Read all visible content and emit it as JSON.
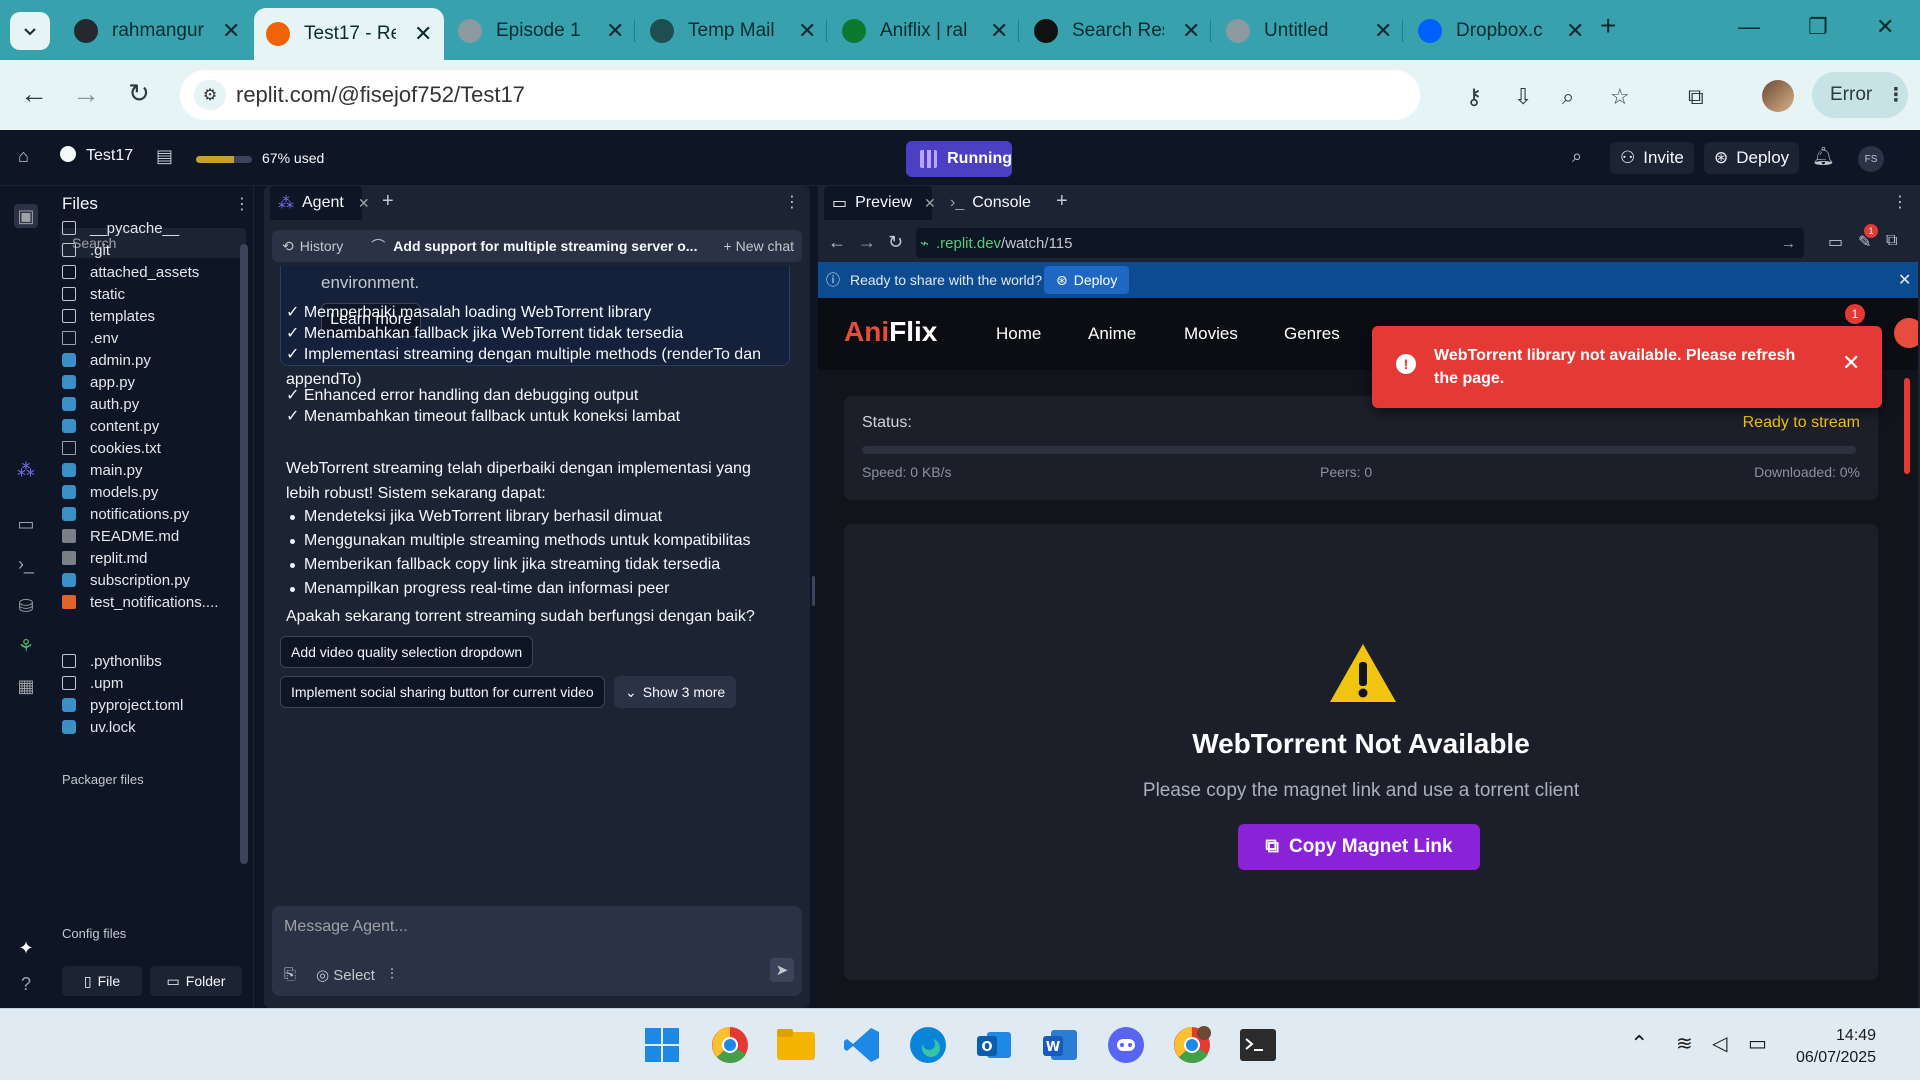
{
  "browser": {
    "tabs": [
      {
        "label": "rahmangur",
        "favicon": "github-icon",
        "color": "#24292e"
      },
      {
        "label": "Test17 - Re",
        "favicon": "replit-icon",
        "color": "#f26207",
        "active": true
      },
      {
        "label": "Episode 1",
        "favicon": "globe-icon",
        "color": "#8a9aa0"
      },
      {
        "label": "Temp Mail",
        "favicon": "tempmail-icon",
        "color": "#1f4e4f"
      },
      {
        "label": "Aniflix | ral",
        "favicon": "aniflix-icon",
        "color": "#0b7a2e"
      },
      {
        "label": "Search Res",
        "favicon": "search-engine-icon",
        "color": "#111111"
      },
      {
        "label": "Untitled",
        "favicon": "globe-icon",
        "color": "#8a9aa0"
      },
      {
        "label": "Dropbox.c",
        "favicon": "dropbox-icon",
        "color": "#0061fe"
      }
    ],
    "url": "replit.com/@fisejof752/Test17",
    "profile_status": "Error"
  },
  "replit": {
    "project_name": "Test17",
    "usage_text": "67% used",
    "usage_fraction": 0.67,
    "run_status": "Running",
    "invite_label": "Invite",
    "deploy_label": "Deploy",
    "user_initials": "FS"
  },
  "files_pane": {
    "title": "Files",
    "search_placeholder": "Search",
    "items": [
      {
        "name": "__pycache__",
        "type": "folder"
      },
      {
        "name": ".git",
        "type": "folder"
      },
      {
        "name": "attached_assets",
        "type": "folder"
      },
      {
        "name": "static",
        "type": "folder"
      },
      {
        "name": "templates",
        "type": "folder"
      },
      {
        "name": ".env",
        "type": "file"
      },
      {
        "name": "admin.py",
        "type": "py"
      },
      {
        "name": "app.py",
        "type": "py"
      },
      {
        "name": "auth.py",
        "type": "py"
      },
      {
        "name": "content.py",
        "type": "py"
      },
      {
        "name": "cookies.txt",
        "type": "file"
      },
      {
        "name": "main.py",
        "type": "py"
      },
      {
        "name": "models.py",
        "type": "py"
      },
      {
        "name": "notifications.py",
        "type": "py"
      },
      {
        "name": "README.md",
        "type": "md"
      },
      {
        "name": "replit.md",
        "type": "md"
      },
      {
        "name": "subscription.py",
        "type": "py"
      },
      {
        "name": "test_notifications....",
        "type": "html"
      }
    ],
    "packager_label": "Packager files",
    "packager_items": [
      {
        "name": ".pythonlibs",
        "type": "folder"
      },
      {
        "name": ".upm",
        "type": "folder"
      },
      {
        "name": "pyproject.toml",
        "type": "py"
      },
      {
        "name": "uv.lock",
        "type": "py"
      }
    ],
    "config_label": "Config files",
    "new_file_label": "File",
    "new_folder_label": "Folder"
  },
  "agent_pane": {
    "tab_label": "Agent",
    "history_label": "History",
    "chat_title": "Add support for multiple streaming server o...",
    "new_chat_label": "New chat",
    "info_text": "environment.",
    "learn_more_label": "Learn more",
    "checklist": [
      "✓ Memperbaiki masalah loading WebTorrent library",
      "✓ Menambahkan fallback jika WebTorrent tidak tersedia",
      "✓ Implementasi streaming dengan multiple methods (renderTo dan appendTo)",
      "✓ Enhanced error handling dan debugging output",
      "✓ Menambahkan timeout fallback untuk koneksi lambat"
    ],
    "summary": "WebTorrent streaming telah diperbaiki dengan implementasi yang lebih robust! Sistem sekarang dapat:",
    "bullets": [
      "Mendeteksi jika WebTorrent library berhasil dimuat",
      "Menggunakan multiple streaming methods untuk kompatibilitas",
      "Memberikan fallback copy link jika streaming tidak tersedia",
      "Menampilkan progress real-time dan informasi peer"
    ],
    "question": "Apakah sekarang torrent streaming sudah berfungsi dengan baik?",
    "suggestions": [
      "Add video quality selection dropdown",
      "Implement social sharing button for current video"
    ],
    "show_more_label": "Show 3 more",
    "message_placeholder": "Message Agent...",
    "select_label": "Select"
  },
  "preview_pane": {
    "tab_preview": "Preview",
    "tab_console": "Console",
    "url_domain": ".replit.dev",
    "url_path": "/watch/115",
    "notification_count": "1",
    "share_text": "Ready to share with the world?",
    "share_deploy_label": "Deploy",
    "site": {
      "logo_red": "Ani",
      "logo_white": "Flix",
      "nav": [
        "Home",
        "Anime",
        "Movies",
        "Genres"
      ],
      "status_label": "Status:",
      "status_value": "Ready to stream",
      "progress_fraction": 0.0,
      "speed_text": "Speed: 0 KB/s",
      "peers_text": "Peers: 0",
      "downloaded_text": "Downloaded: 0%",
      "warning_title": "WebTorrent Not Available",
      "warning_subtitle": "Please copy the magnet link and use a torrent client",
      "copy_button_label": "Copy Magnet Link",
      "toast_message": "WebTorrent library not available. Please refresh the page.",
      "toast_badge": "1"
    }
  },
  "taskbar": {
    "time": "14:49",
    "date": "06/07/2025"
  }
}
